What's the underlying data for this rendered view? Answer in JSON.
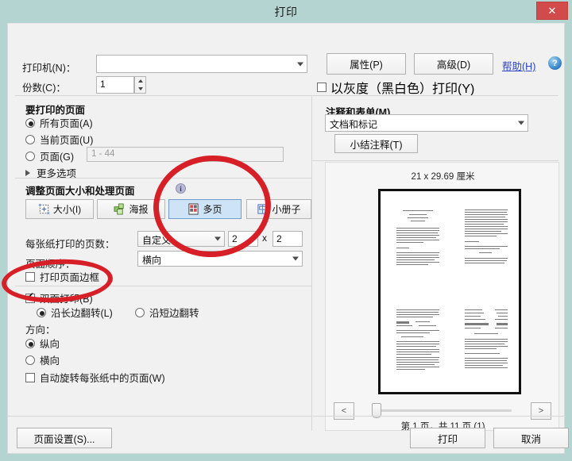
{
  "window": {
    "title": "打印",
    "close_label": "✕"
  },
  "printer": {
    "label": "打印机(N)：",
    "value": "",
    "properties_label": "属性(P)",
    "advanced_label": "高级(D)",
    "help_label": "帮助(H)",
    "help_icon_glyph": "?"
  },
  "copies": {
    "label": "份数(C)：",
    "value": "1",
    "grayscale_label": "以灰度（黑白色）打印(Y)",
    "grayscale_checked": false
  },
  "pages_to_print": {
    "title": "要打印的页面",
    "options": [
      {
        "label": "所有页面(A)",
        "selected": true
      },
      {
        "label": "当前页面(U)",
        "selected": false
      },
      {
        "label": "页面(G)",
        "selected": false
      }
    ],
    "range_placeholder": "1 - 44",
    "more_options_label": "更多选项"
  },
  "page_sizing": {
    "title": "调整页面大小和处理页面",
    "info_icon_glyph": "i",
    "buttons": [
      {
        "label": "大小(I)",
        "icon": "size-icon",
        "selected": false
      },
      {
        "label": "海报",
        "icon": "poster-icon",
        "selected": false
      },
      {
        "label": "多页",
        "icon": "multipage-icon",
        "selected": true
      },
      {
        "label": "小册子",
        "icon": "booklet-icon",
        "selected": false
      }
    ],
    "pages_per_sheet_label": "每张纸打印的页数：",
    "pages_per_sheet_value": "自定义...",
    "columns": "2",
    "x_separator": "x",
    "rows": "2",
    "page_order_label": "页面顺序：",
    "page_order_value": "横向",
    "print_border_label": "打印页面边框",
    "print_border_checked": false,
    "duplex_label": "双面打印(B)",
    "duplex_checked": true,
    "duplex_long_label": "沿长边翻转(L)",
    "duplex_long_selected": true,
    "duplex_short_label": "沿短边翻转",
    "duplex_short_selected": false,
    "orientation_label": "方向：",
    "orientation_portrait": "纵向",
    "orientation_portrait_selected": true,
    "orientation_landscape": "横向",
    "orientation_landscape_selected": false,
    "auto_rotate_label": "自动旋转每张纸中的页面(W)",
    "auto_rotate_checked": false
  },
  "comments_forms": {
    "title": "注释和表单(M)",
    "value": "文档和标记",
    "summary_button_label": "小结注释(T)"
  },
  "preview": {
    "paper_size_label": "21 x 29.69 厘米",
    "prev_label": "<",
    "next_label": ">",
    "page_indicator": "第 1 页，共 11 页 (1)"
  },
  "footer": {
    "page_setup_label": "页面设置(S)...",
    "print_label": "打印",
    "cancel_label": "取消"
  },
  "colors": {
    "window_frame": "#b4d4d2",
    "dialog_bg": "#f1f1f1",
    "close_button": "#d14b4b",
    "selected_button": "#cfe3f7",
    "link": "#2b42c8",
    "annotation": "#d61f26"
  }
}
